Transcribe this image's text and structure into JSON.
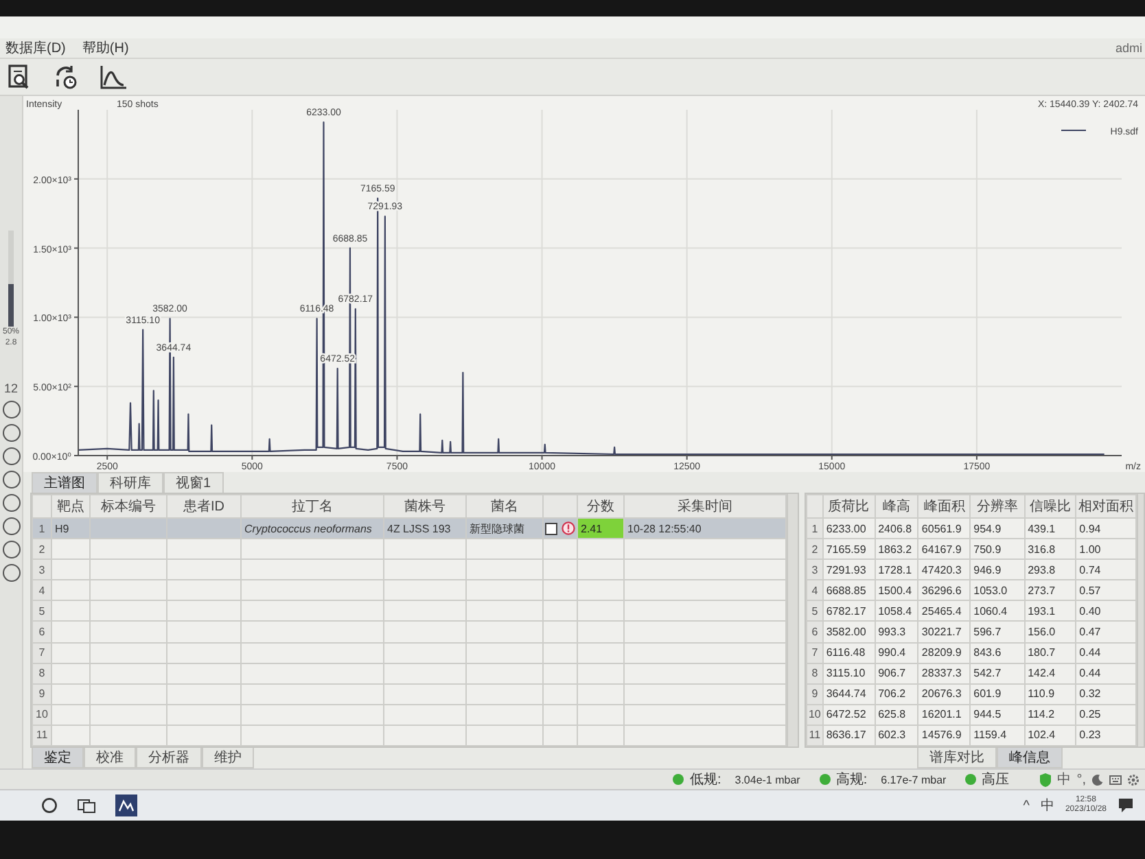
{
  "menu": [
    {
      "label": "数据库(D)"
    },
    {
      "label": "帮助(H)"
    }
  ],
  "user": "admi",
  "side_panel": {
    "slider": {
      "level": 0.45
    },
    "readouts": [
      "50%",
      "2.8"
    ],
    "count": "12"
  },
  "spectrum": {
    "shots": "150 shots",
    "cursor_readout": "X: 15440.39   Y: 2402.74",
    "chart_data": {
      "type": "line",
      "xlabel": "m/z",
      "ylabel": "Intensity",
      "x": [
        2000,
        2500,
        2880,
        2900,
        2920,
        3040,
        3050,
        3060,
        3100,
        3115.1,
        3130,
        3290,
        3300,
        3310,
        3370,
        3380,
        3390,
        3570,
        3582,
        3595,
        3635,
        3644.74,
        3655,
        3890,
        3900,
        3910,
        4290,
        4300,
        4310,
        4700,
        5290,
        5300,
        5310,
        5900,
        6105,
        6116.48,
        6125,
        6222,
        6233,
        6245,
        6462,
        6472.52,
        6483,
        6678,
        6688.85,
        6698,
        6772,
        6782.17,
        6792,
        7000,
        7155,
        7165.59,
        7175,
        7282,
        7291.93,
        7302,
        7600,
        7890,
        7900,
        7910,
        8270,
        8280,
        8290,
        8410,
        8420,
        8430,
        8626,
        8636.17,
        8646,
        9240,
        9250,
        9260,
        10040,
        10050,
        10060,
        11240,
        11250,
        11260,
        12000,
        14000,
        16000,
        18000,
        19700
      ],
      "series": [
        {
          "name": "H9.sdf",
          "color": "#3e4462",
          "values": [
            40,
            50,
            40,
            380,
            40,
            40,
            230,
            40,
            40,
            910,
            40,
            40,
            470,
            40,
            40,
            400,
            40,
            40,
            990,
            40,
            40,
            710,
            40,
            40,
            300,
            30,
            30,
            220,
            30,
            30,
            30,
            120,
            30,
            40,
            40,
            990,
            60,
            60,
            2410,
            60,
            50,
            630,
            50,
            60,
            1500,
            60,
            60,
            1060,
            50,
            40,
            50,
            1860,
            60,
            60,
            1730,
            50,
            30,
            30,
            300,
            30,
            20,
            110,
            20,
            20,
            100,
            20,
            20,
            600,
            20,
            20,
            120,
            20,
            20,
            80,
            20,
            10,
            60,
            10,
            10,
            10,
            10,
            10,
            10
          ]
        }
      ],
      "grid": true,
      "xlim": [
        2000,
        20000
      ],
      "ylim": [
        0,
        2500
      ],
      "xticks": [
        2500,
        5000,
        7500,
        10000,
        12500,
        15000,
        17500
      ],
      "yticks": [
        {
          "value": 0,
          "label": "0.00×10⁰"
        },
        {
          "value": 500,
          "label": "5.00×10²"
        },
        {
          "value": 1000,
          "label": "1.00×10³"
        },
        {
          "value": 1500,
          "label": "1.50×10³"
        },
        {
          "value": 2000,
          "label": "2.00×10³"
        }
      ],
      "annotations": [
        {
          "x": 3115.1,
          "y": 910,
          "text": "3115.10"
        },
        {
          "x": 3582.0,
          "y": 990,
          "text": "3582.00"
        },
        {
          "x": 3644.74,
          "y": 710,
          "text": "3644.74"
        },
        {
          "x": 6116.48,
          "y": 990,
          "text": "6116.48"
        },
        {
          "x": 6233.0,
          "y": 2410,
          "text": "6233.00"
        },
        {
          "x": 6472.52,
          "y": 630,
          "text": "6472.52"
        },
        {
          "x": 6688.85,
          "y": 1500,
          "text": "6688.85"
        },
        {
          "x": 6782.17,
          "y": 1060,
          "text": "6782.17"
        },
        {
          "x": 7165.59,
          "y": 1860,
          "text": "7165.59"
        },
        {
          "x": 7291.93,
          "y": 1730,
          "text": "7291.93"
        }
      ]
    }
  },
  "view_tabs": [
    {
      "label": "主谱图",
      "selected": true
    },
    {
      "label": "科研库",
      "selected": false
    },
    {
      "label": "视窗1",
      "selected": false
    }
  ],
  "result_table": {
    "columns": [
      "靶点",
      "标本编号",
      "患者ID",
      "拉丁名",
      "菌株号",
      "菌名",
      "分数",
      "采集时间"
    ],
    "rows": [
      {
        "number": "1",
        "selected": true,
        "target": "H9",
        "latin_name": "Cryptococcus neoformans",
        "strain": "4Z LJSS 193",
        "species": "新型隐球菌",
        "checked": false,
        "warning": true,
        "score": "2.41",
        "color": "#7ed23a",
        "time": "10-28 12:55:40"
      },
      {
        "number": "2",
        "selected": false
      },
      {
        "number": "3",
        "selected": false
      },
      {
        "number": "4",
        "selected": false
      },
      {
        "number": "5",
        "selected": false
      },
      {
        "number": "6",
        "selected": false
      },
      {
        "number": "7",
        "selected": false
      },
      {
        "number": "8",
        "selected": false
      },
      {
        "number": "9",
        "selected": false
      },
      {
        "number": "10",
        "selected": false
      },
      {
        "number": "11",
        "selected": false
      }
    ]
  },
  "bottom_tabs": [
    {
      "label": "鉴定",
      "selected": true
    },
    {
      "label": "校准",
      "selected": false
    },
    {
      "label": "分析器",
      "selected": false
    },
    {
      "label": "维护",
      "selected": false
    }
  ],
  "peak_table": {
    "columns": [
      "质荷比",
      "峰高",
      "峰面积",
      "分辨率",
      "信噪比",
      "相对面积"
    ],
    "rows": [
      {
        "number": "1",
        "values": [
          "6233.00",
          "2406.8",
          "60561.9",
          "954.9",
          "439.1",
          "0.94"
        ]
      },
      {
        "number": "2",
        "values": [
          "7165.59",
          "1863.2",
          "64167.9",
          "750.9",
          "316.8",
          "1.00"
        ]
      },
      {
        "number": "3",
        "values": [
          "7291.93",
          "1728.1",
          "47420.3",
          "946.9",
          "293.8",
          "0.74"
        ]
      },
      {
        "number": "4",
        "values": [
          "6688.85",
          "1500.4",
          "36296.6",
          "1053.0",
          "273.7",
          "0.57"
        ]
      },
      {
        "number": "5",
        "values": [
          "6782.17",
          "1058.4",
          "25465.4",
          "1060.4",
          "193.1",
          "0.40"
        ]
      },
      {
        "number": "6",
        "values": [
          "3582.00",
          "993.3",
          "30221.7",
          "596.7",
          "156.0",
          "0.47"
        ]
      },
      {
        "number": "7",
        "values": [
          "6116.48",
          "990.4",
          "28209.9",
          "843.6",
          "180.7",
          "0.44"
        ]
      },
      {
        "number": "8",
        "values": [
          "3115.10",
          "906.7",
          "28337.3",
          "542.7",
          "142.4",
          "0.44"
        ]
      },
      {
        "number": "9",
        "values": [
          "3644.74",
          "706.2",
          "20676.3",
          "601.9",
          "110.9",
          "0.32"
        ]
      },
      {
        "number": "10",
        "values": [
          "6472.52",
          "625.8",
          "16201.1",
          "944.5",
          "114.2",
          "0.25"
        ]
      },
      {
        "number": "11",
        "values": [
          "8636.17",
          "602.3",
          "14576.9",
          "1159.4",
          "102.4",
          "0.23"
        ]
      }
    ]
  },
  "peak_tabs": [
    {
      "label": "谱库对比",
      "selected": false
    },
    {
      "label": "峰信息",
      "selected": true
    }
  ],
  "status_bar": [
    {
      "label": "低规:",
      "value": "3.04e-1 mbar",
      "color": "#3fae3a"
    },
    {
      "label": "高规:",
      "value": "6.17e-7 mbar",
      "color": "#3fae3a"
    },
    {
      "label": "高压",
      "color": "#3fae3a"
    }
  ],
  "ime_bar": [
    "中",
    "°,"
  ],
  "taskbar": {
    "tray": [
      "^",
      "中"
    ],
    "time": "12:58",
    "date": "2023/10/28"
  }
}
